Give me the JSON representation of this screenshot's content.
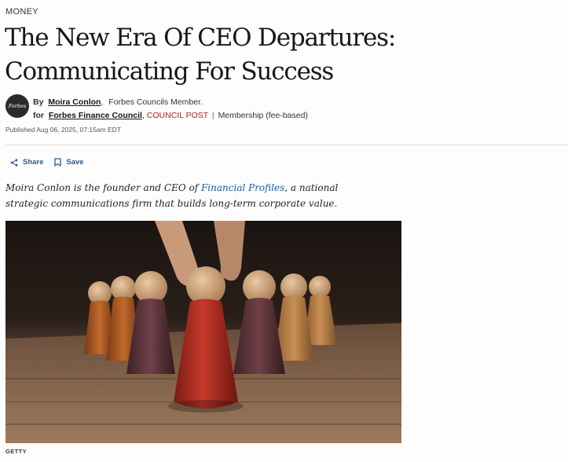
{
  "section": "MONEY",
  "headline": "The New Era Of CEO Departures: Communicating For Success",
  "avatar_text": "Forbes",
  "byline": {
    "by": "By",
    "author": "Moira Conlon",
    "member": "Forbes Councils Member.",
    "for": "for",
    "council": "Forbes Finance Council",
    "post_type": "COUNCIL POST",
    "separator": "|",
    "membership": "Membership (fee-based)"
  },
  "published": "Published Aug 06, 2025, 07:15am EDT",
  "actions": {
    "share": "Share",
    "save": "Save"
  },
  "dek": {
    "before": "Moira Conlon is the founder and CEO of ",
    "link": "Financial Profiles",
    "after": ", a national strategic communications firm that builds long-term corporate value."
  },
  "image_credit": "GETTY",
  "colors": {
    "accent_link": "#1d5ba4",
    "council_post": "#b51e1e",
    "action": "#2a5c8f"
  }
}
